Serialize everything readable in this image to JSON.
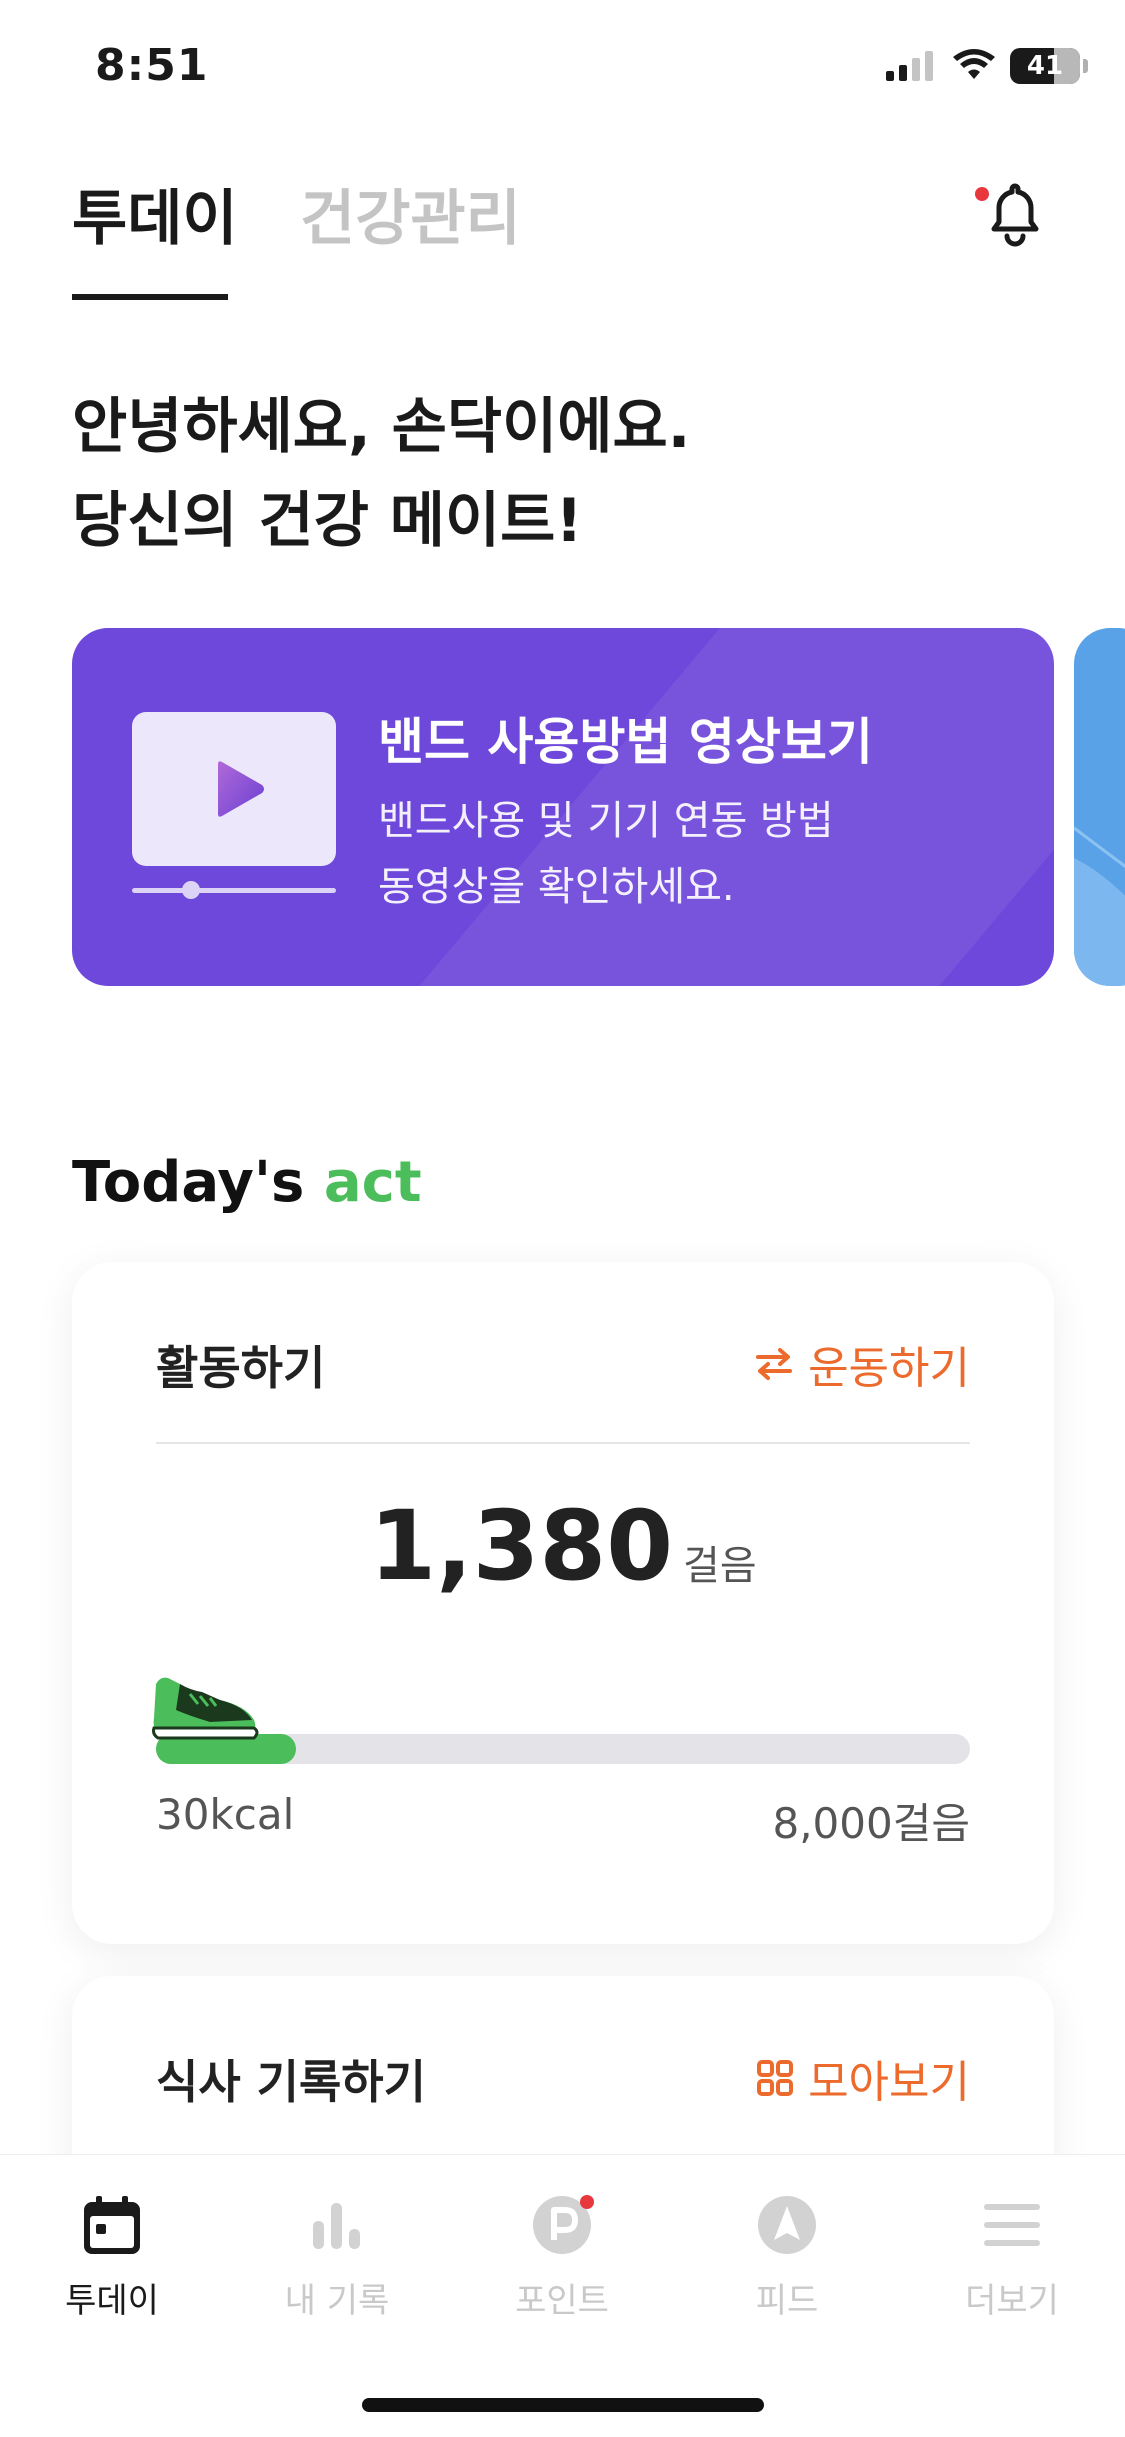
{
  "status_bar": {
    "time": "8:51",
    "battery": "41"
  },
  "header": {
    "tabs": [
      {
        "label": "투데이",
        "active": true
      },
      {
        "label": "건강관리",
        "active": false
      }
    ],
    "notification_icon": "bell-icon",
    "has_notification": true
  },
  "greeting": {
    "line1": "안녕하세요, 손닥이에요.",
    "line2": "당신의 건강 메이트!"
  },
  "banner": {
    "title": "밴드 사용방법 영상보기",
    "subtitle_line1": "밴드사용 및 기기 연동 방법",
    "subtitle_line2": "동영상을 확인하세요.",
    "color": "#6e47db"
  },
  "section": {
    "title_prefix": "Today's",
    "title_accent": "act",
    "accent_color": "#4cbd5b"
  },
  "activity_card": {
    "title": "활동하기",
    "action_label": "운동하기",
    "steps": "1,380",
    "steps_unit": "걸음",
    "progress_fraction": 0.1725,
    "kcal": "30kcal",
    "goal": "8,000걸음",
    "accent_color": "#ed6a2d"
  },
  "meal_card": {
    "title": "식사 기록하기",
    "action_label": "모아보기"
  },
  "bottom_nav": {
    "items": [
      {
        "label": "투데이",
        "icon": "calendar-icon",
        "active": true
      },
      {
        "label": "내 기록",
        "icon": "bar-chart-icon",
        "active": false
      },
      {
        "label": "포인트",
        "icon": "point-icon",
        "active": false,
        "badge": true
      },
      {
        "label": "피드",
        "icon": "compass-icon",
        "active": false
      },
      {
        "label": "더보기",
        "icon": "menu-icon",
        "active": false
      }
    ]
  }
}
